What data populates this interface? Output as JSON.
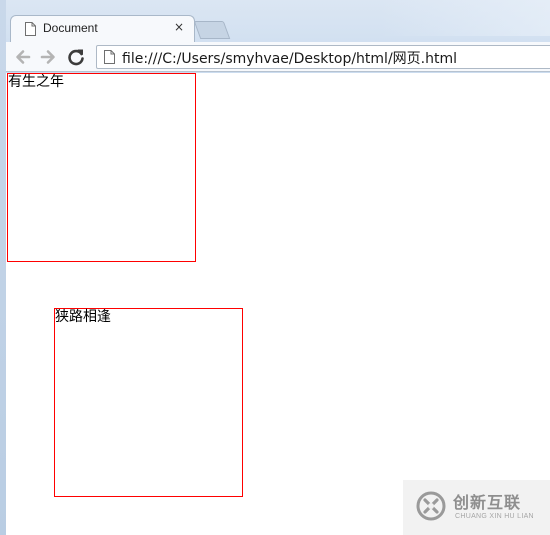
{
  "browser": {
    "tab": {
      "title": "Document",
      "close_glyph": "×",
      "icon": "document-page-icon"
    },
    "toolbar": {
      "back_icon": "back-arrow-icon",
      "forward_icon": "forward-arrow-icon",
      "reload_icon": "reload-icon",
      "url": "file:///C:/Users/smyhvae/Desktop/html/网页.html"
    }
  },
  "page": {
    "boxes": [
      {
        "text": "有生之年",
        "border_color": "#ff0000"
      },
      {
        "text": "狭路相逢",
        "border_color": "#ff0000"
      }
    ]
  },
  "watermark": {
    "name": "创新互联",
    "subtitle": "CHUANG XIN HU LIAN",
    "icon": "brand-logo-icon"
  }
}
